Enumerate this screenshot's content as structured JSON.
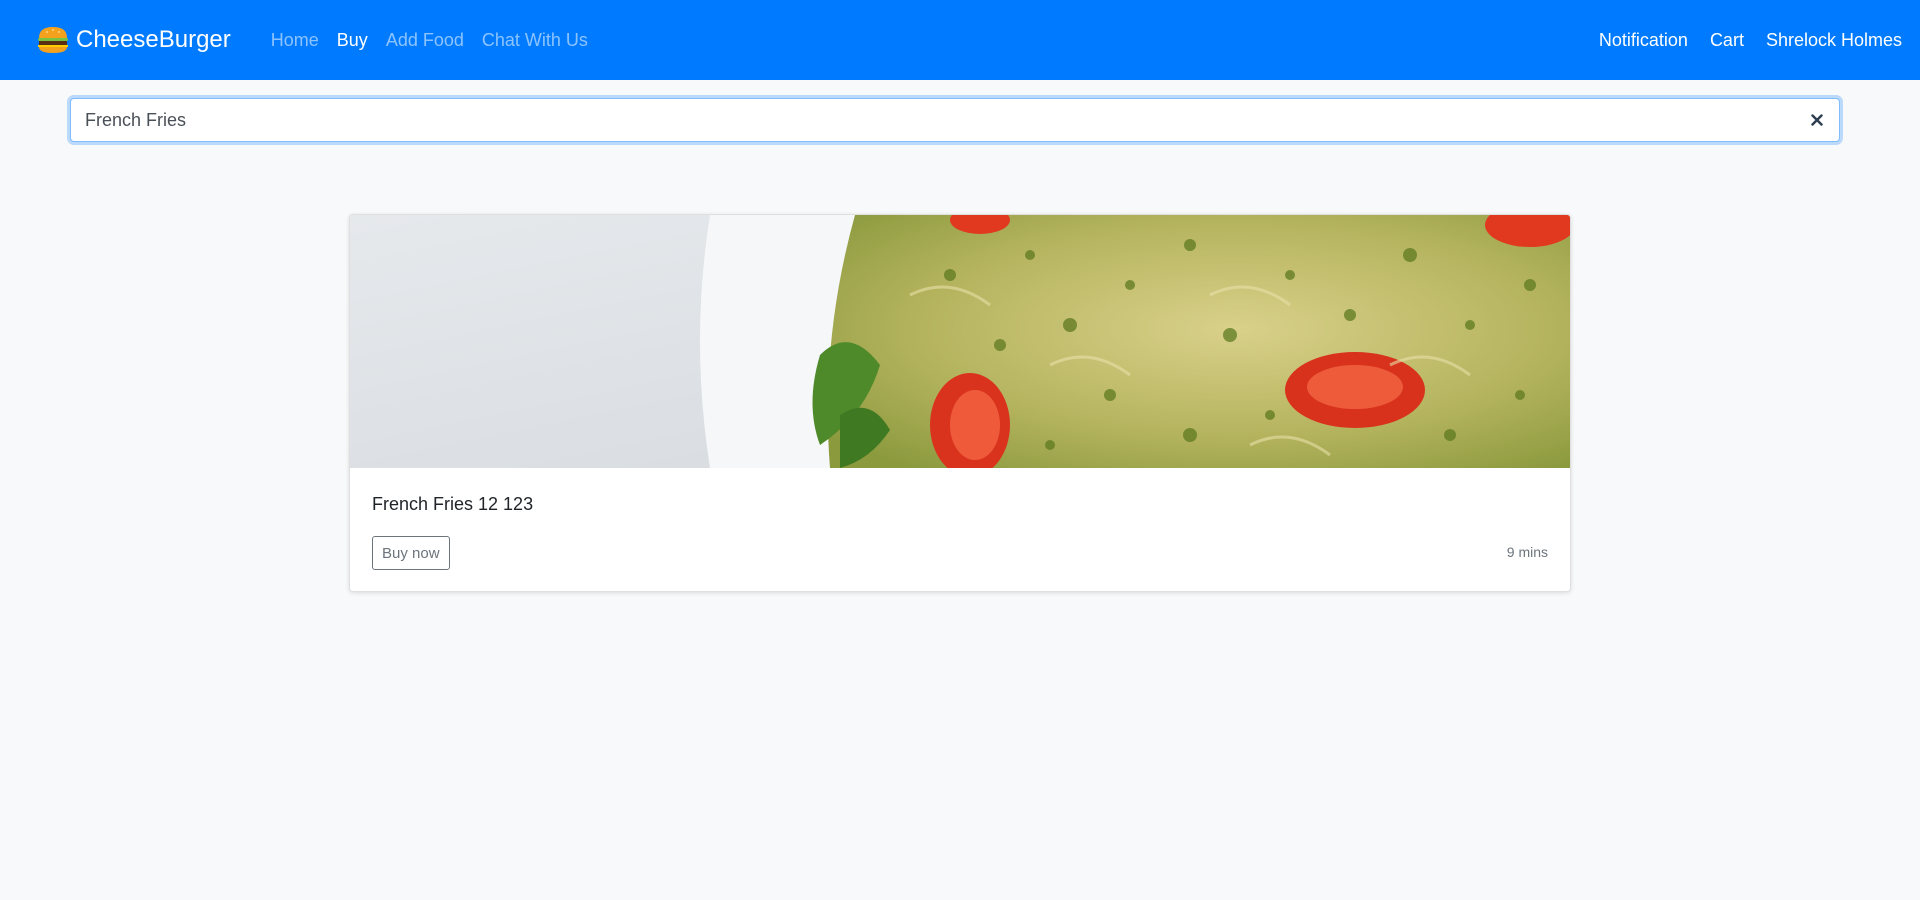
{
  "navbar": {
    "brand": "CheeseBurger",
    "brand_icon": "burger-icon",
    "links": [
      {
        "label": "Home",
        "active": false
      },
      {
        "label": "Buy",
        "active": true
      },
      {
        "label": "Add Food",
        "active": false
      },
      {
        "label": "Chat With Us",
        "active": false
      }
    ],
    "right_links": [
      {
        "label": "Notification"
      },
      {
        "label": "Cart"
      },
      {
        "label": "Shrelock Holmes"
      }
    ],
    "color": "#007bff"
  },
  "search": {
    "value": "French Fries",
    "clear_icon": "close-icon"
  },
  "results": [
    {
      "title": "French Fries 12 123",
      "button_label": "Buy now",
      "time": "9 mins",
      "image": "pasta-salad-photo"
    }
  ]
}
